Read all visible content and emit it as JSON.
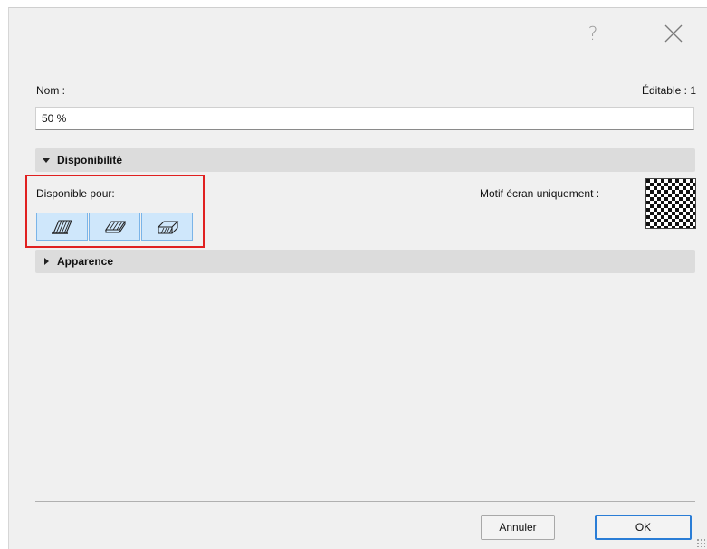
{
  "dialog": {
    "help_label": "?",
    "close_icon": "close-icon"
  },
  "name_field": {
    "label": "Nom :",
    "editable_label": "Éditable : 1",
    "value": "50 %"
  },
  "sections": {
    "availability": {
      "title": "Disponibilité",
      "expanded": true
    },
    "appearance": {
      "title": "Apparence",
      "expanded": false
    }
  },
  "availability": {
    "available_for_label": "Disponible pour:",
    "tools": [
      {
        "icon": "cut-fill-icon",
        "selected": true
      },
      {
        "icon": "cover-fill-icon",
        "selected": true
      },
      {
        "icon": "drafting-fill-icon",
        "selected": true
      }
    ],
    "screen_only_label": "Motif écran uniquement :"
  },
  "footer": {
    "cancel_label": "Annuler",
    "ok_label": "OK"
  },
  "colors": {
    "highlight": "#e02020",
    "selected_button": "#cfe7fb",
    "ok_border": "#2a7dd6"
  }
}
